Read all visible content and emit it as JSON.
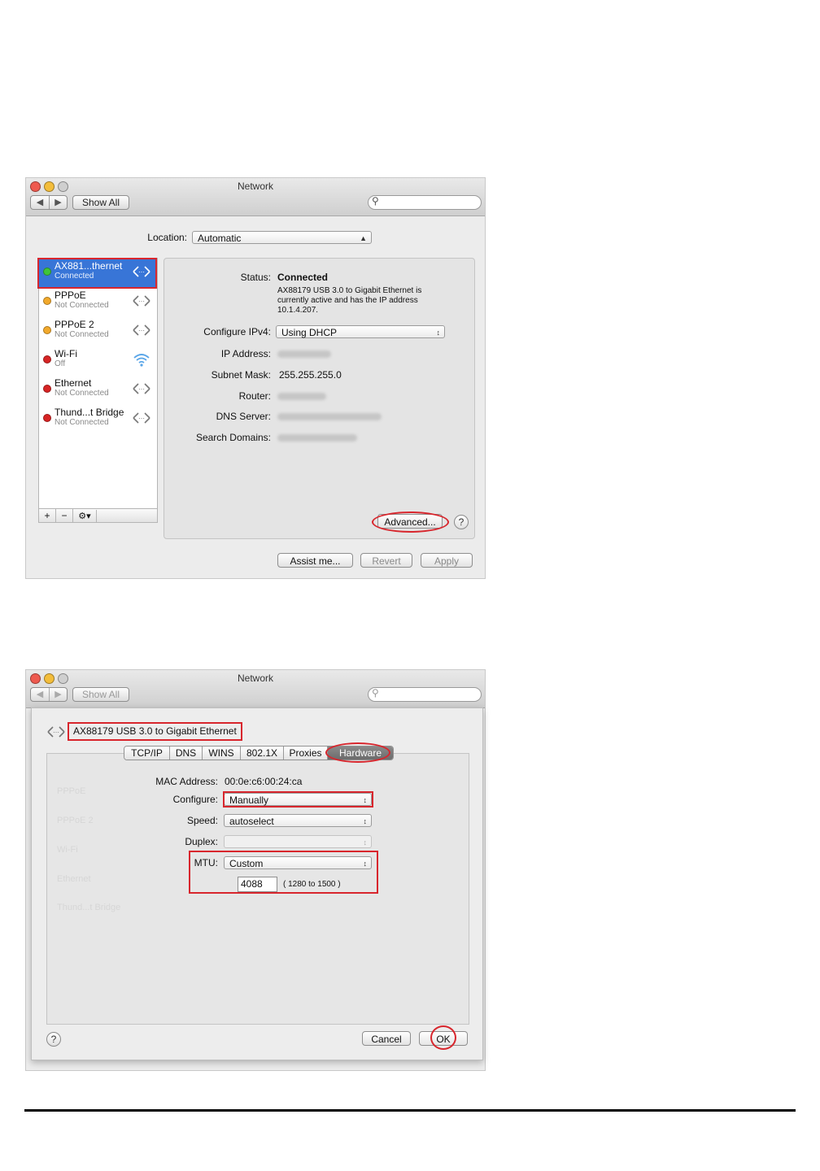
{
  "window1": {
    "title": "Network",
    "show_all": "Show All",
    "location_label": "Location:",
    "location_value": "Automatic",
    "services": [
      {
        "name": "AX881...thernet",
        "status": "Connected",
        "dot_color": "#3fc43a",
        "icon": "ethernet-icon"
      },
      {
        "name": "PPPoE",
        "status": "Not Connected",
        "dot_color": "#f2a92c",
        "icon": "ethernet-icon"
      },
      {
        "name": "PPPoE 2",
        "status": "Not Connected",
        "dot_color": "#f2a92c",
        "icon": "ethernet-icon"
      },
      {
        "name": "Wi-Fi",
        "status": "Off",
        "dot_color": "#d72424",
        "icon": "wifi-icon"
      },
      {
        "name": "Ethernet",
        "status": "Not Connected",
        "dot_color": "#d72424",
        "icon": "ethernet-icon"
      },
      {
        "name": "Thund...t Bridge",
        "status": "Not Connected",
        "dot_color": "#d72424",
        "icon": "ethernet-icon"
      }
    ],
    "status_label": "Status:",
    "status_value": "Connected",
    "status_desc": [
      "AX88179 USB 3.0 to Gigabit Ethernet is",
      "currently active and has the IP address",
      "10.1.4.207."
    ],
    "configure_label": "Configure IPv4:",
    "configure_value": "Using DHCP",
    "ip_label": "IP Address:",
    "subnet_label": "Subnet Mask:",
    "subnet_value": "255.255.255.0",
    "router_label": "Router:",
    "dns_label": "DNS Server:",
    "search_domains_label": "Search Domains:",
    "advanced": "Advanced...",
    "help": "?",
    "assist": "Assist me...",
    "revert": "Revert",
    "apply": "Apply",
    "list_add": "+",
    "list_remove": "−",
    "list_gear": "⚙▾"
  },
  "window2": {
    "title": "Network",
    "show_all": "Show All",
    "header": "AX88179 USB 3.0 to Gigabit Ethernet",
    "tabs": [
      "TCP/IP",
      "DNS",
      "WINS",
      "802.1X",
      "Proxies",
      "Hardware"
    ],
    "mac_label": "MAC Address:",
    "mac_value": "00:0e:c6:00:24:ca",
    "configure_label": "Configure:",
    "configure_value": "Manually",
    "speed_label": "Speed:",
    "speed_value": "autoselect",
    "duplex_label": "Duplex:",
    "mtu_label": "MTU:",
    "mtu_value": "Custom",
    "mtu_field": "4088",
    "mtu_range": "( 1280 to 1500 )",
    "help": "?",
    "cancel": "Cancel",
    "ok": "OK"
  },
  "colors": {
    "accent": "#3875d7",
    "annotation": "#d8262d",
    "active_tab": "#7a7a7a"
  }
}
